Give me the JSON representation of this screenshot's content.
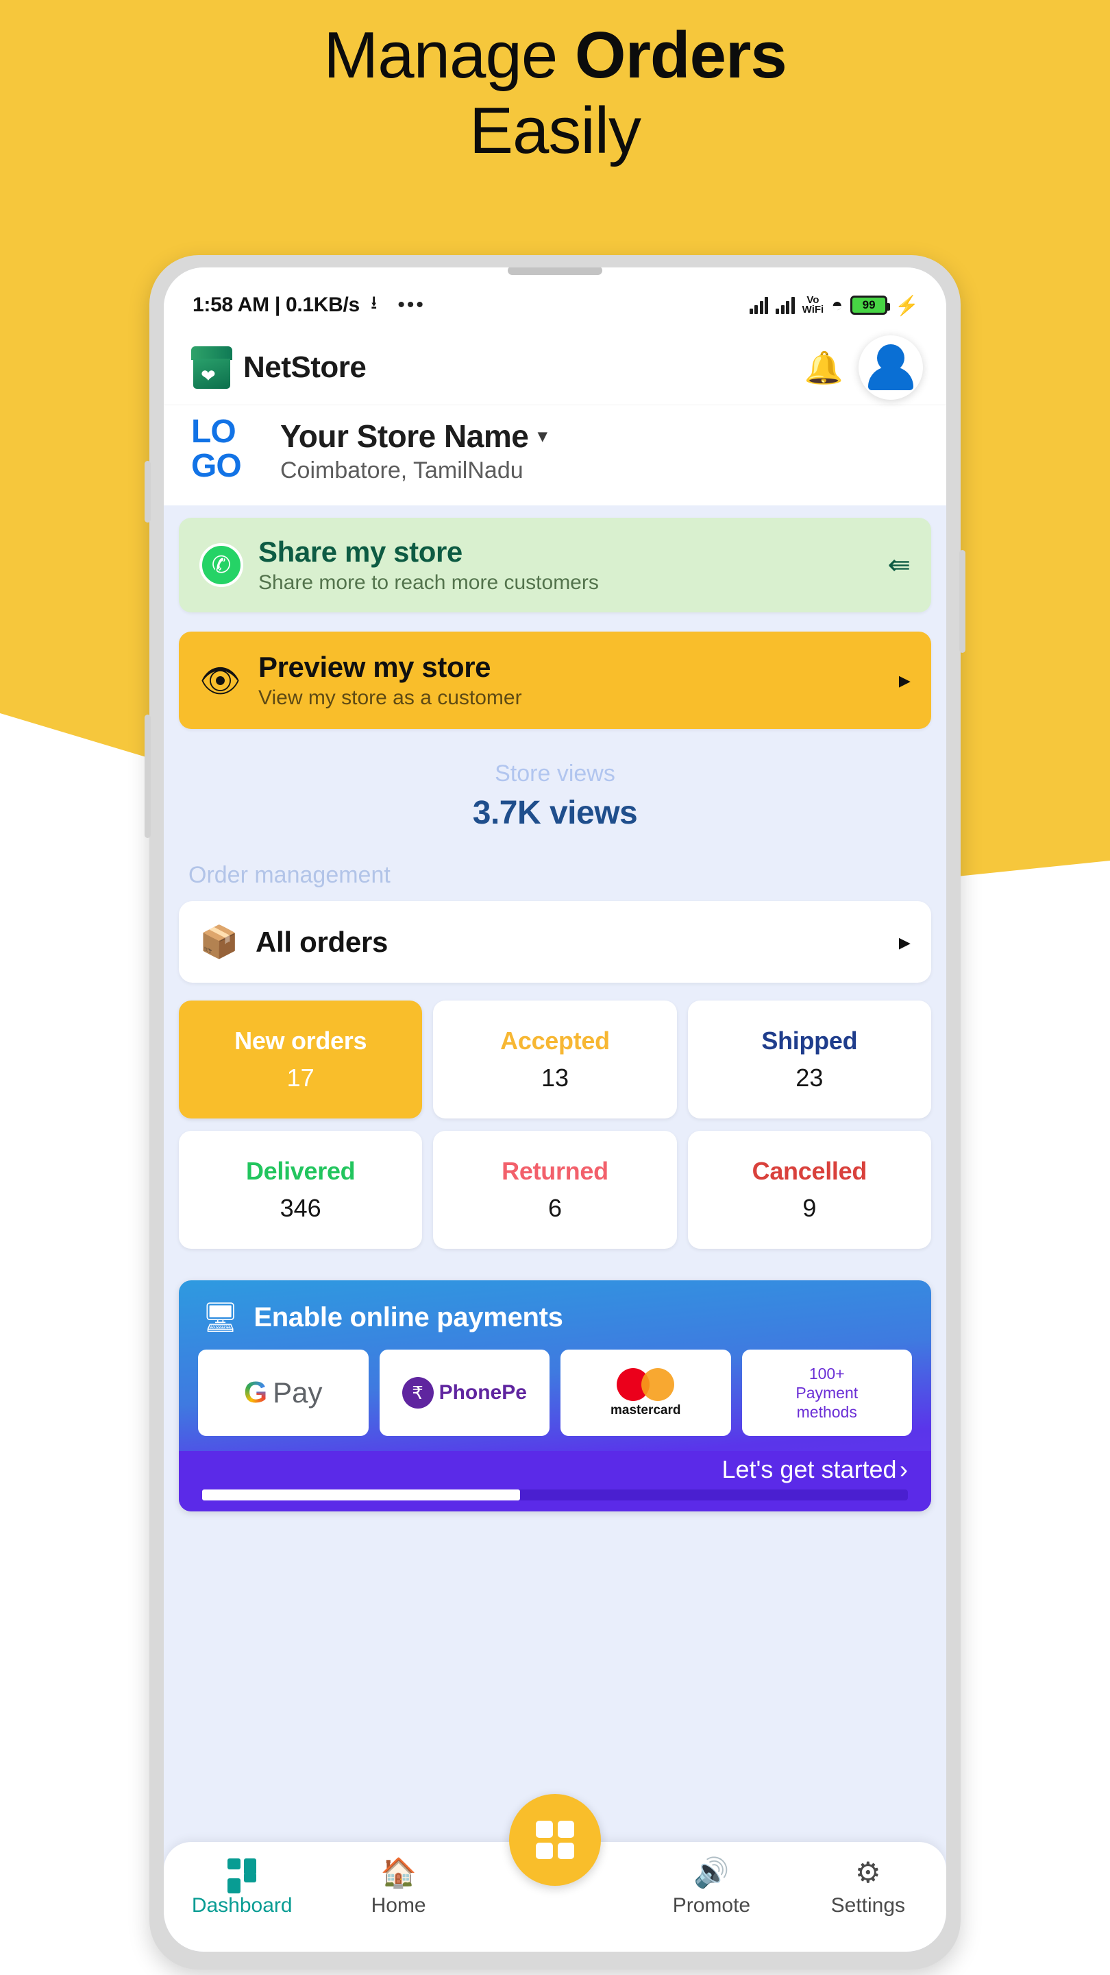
{
  "promo": {
    "headline_line1_regular": "Manage ",
    "headline_line1_bold": "Orders",
    "headline_line2": "Easily",
    "bg_color": "#F6C73C"
  },
  "statusbar": {
    "time_and_speed": "1:58 AM | 0.1KB/s",
    "download_icon": "download-icon",
    "menu_dots": "•••",
    "volte_line1": "Vo",
    "volte_line2": "WiFi",
    "wifi_icon": "wifi-icon",
    "battery_percent": "99",
    "charging_icon": "⚡"
  },
  "appbar": {
    "brand_name": "NetStore",
    "store_icon": "store-icon",
    "bell_icon": "bell-icon",
    "avatar": "user-avatar"
  },
  "store": {
    "logo_line1": "LO",
    "logo_line2": "GO",
    "name": "Your Store Name",
    "caret": "▾",
    "location": "Coimbatore, TamilNadu"
  },
  "share_card": {
    "icon": "whatsapp-icon",
    "title": "Share my store",
    "subtitle": "Share more to reach more customers",
    "action_icon": "share-icon"
  },
  "preview_card": {
    "icon": "eye-icon",
    "title": "Preview my store",
    "subtitle": "View my store as a customer",
    "chevron": "▸",
    "bg_color": "#F9BE2B"
  },
  "store_views": {
    "label": "Store views",
    "value": "3.7K views",
    "value_color": "#1F4E8C"
  },
  "order_management": {
    "section_label": "Order management",
    "all_orders_label": "All orders",
    "all_orders_icon": "package-icon",
    "all_orders_chevron": "▸",
    "stats": [
      {
        "label": "New orders",
        "value": "17",
        "color": "#ffffff",
        "active": true
      },
      {
        "label": "Accepted",
        "value": "13",
        "color": "#F7B733",
        "active": false
      },
      {
        "label": "Shipped",
        "value": "23",
        "color": "#1F3D8C",
        "active": false
      },
      {
        "label": "Delivered",
        "value": "346",
        "color": "#22C55E",
        "active": false
      },
      {
        "label": "Returned",
        "value": "6",
        "color": "#F2606B",
        "active": false
      },
      {
        "label": "Cancelled",
        "value": "9",
        "color": "#D9413C",
        "active": false
      }
    ]
  },
  "payments": {
    "title": "Enable online payments",
    "title_icon": "payment-monitor-icon",
    "logos": [
      {
        "type": "gpay",
        "g": "G",
        "text": "Pay"
      },
      {
        "type": "phonepe",
        "mark": "₹",
        "text": "PhonePe"
      },
      {
        "type": "mastercard",
        "text": "mastercard"
      },
      {
        "type": "more",
        "line1": "100+",
        "line2": "Payment",
        "line3": "methods"
      }
    ],
    "cta_label": "Let's get started",
    "cta_chevron": "›",
    "progress_percent": "45"
  },
  "bottom_nav": {
    "items": [
      {
        "label": "Dashboard",
        "icon": "dashboard-grid-icon",
        "active": true
      },
      {
        "label": "Home",
        "icon": "home-icon",
        "active": false
      },
      {
        "label": "Promote",
        "icon": "megaphone-icon",
        "active": false
      },
      {
        "label": "Settings",
        "icon": "gear-icon",
        "active": false
      }
    ],
    "fab_icon": "grid-apps-icon"
  }
}
